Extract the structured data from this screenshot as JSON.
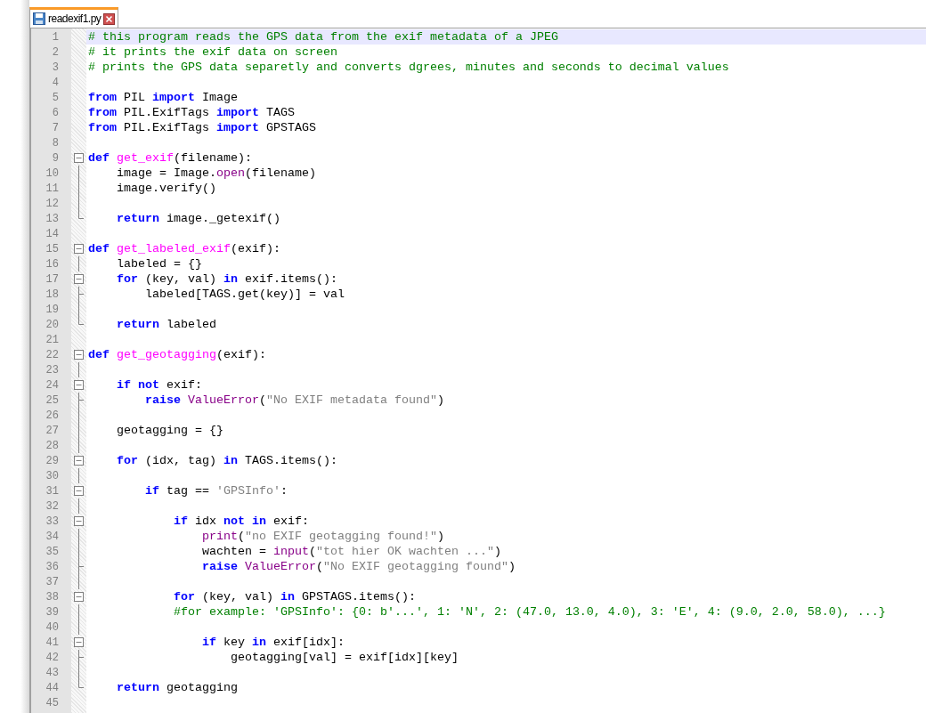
{
  "tab": {
    "title": "readexif1.py",
    "selected": true
  },
  "lines": [
    {
      "number": "1",
      "current": true,
      "kind": "plain",
      "tokens": [
        {
          "kind": "comment",
          "text": "# this program reads the GPS data from the exif metadata of a JPEG"
        }
      ]
    },
    {
      "number": "2",
      "current": false,
      "kind": "plain",
      "tokens": [
        {
          "kind": "comment",
          "text": "# it prints the exif data on screen"
        }
      ]
    },
    {
      "number": "3",
      "current": false,
      "kind": "plain",
      "tokens": [
        {
          "kind": "comment",
          "text": "# prints the GPS data separetly and converts dgrees, minutes and seconds to decimal values"
        }
      ]
    },
    {
      "number": "4",
      "current": false,
      "kind": "plain"
    },
    {
      "number": "5",
      "current": false,
      "kind": "plain",
      "tokens": [
        {
          "kind": "keyword",
          "text": "from"
        },
        {
          "kind": "plain",
          "text": " PIL "
        },
        {
          "kind": "keyword",
          "text": "import"
        },
        {
          "kind": "plain",
          "text": " Image"
        }
      ]
    },
    {
      "number": "6",
      "current": false,
      "kind": "plain",
      "tokens": [
        {
          "kind": "keyword",
          "text": "from"
        },
        {
          "kind": "plain",
          "text": " PIL.ExifTags "
        },
        {
          "kind": "keyword",
          "text": "import"
        },
        {
          "kind": "plain",
          "text": " TAGS"
        }
      ]
    },
    {
      "number": "7",
      "current": false,
      "kind": "plain",
      "tokens": [
        {
          "kind": "keyword",
          "text": "from"
        },
        {
          "kind": "plain",
          "text": " PIL.ExifTags "
        },
        {
          "kind": "keyword",
          "text": "import"
        },
        {
          "kind": "plain",
          "text": " GPSTAGS"
        }
      ]
    },
    {
      "number": "8",
      "current": false,
      "kind": "plain"
    },
    {
      "number": "9",
      "current": false,
      "kind": "fold_start",
      "tokens": [
        {
          "kind": "keyword",
          "text": "def "
        },
        {
          "kind": "defname",
          "text": "get_exif"
        },
        {
          "kind": "plain",
          "text": "(filename):"
        }
      ]
    },
    {
      "number": "10",
      "current": false,
      "kind": "fold_body",
      "tokens": [
        {
          "kind": "plain",
          "text": "    image = Image."
        },
        {
          "kind": "builtin",
          "text": "open"
        },
        {
          "kind": "plain",
          "text": "(filename)"
        }
      ]
    },
    {
      "number": "11",
      "current": false,
      "kind": "fold_body",
      "tokens": [
        {
          "kind": "plain",
          "text": "    image.verify()"
        }
      ]
    },
    {
      "number": "12",
      "current": false,
      "kind": "fold_body"
    },
    {
      "number": "13",
      "current": false,
      "kind": "fold_end",
      "tokens": [
        {
          "kind": "keyword",
          "text": "    return"
        },
        {
          "kind": "plain",
          "text": " image._getexif()"
        }
      ]
    },
    {
      "number": "14",
      "current": false,
      "kind": "plain"
    },
    {
      "number": "15",
      "current": false,
      "kind": "fold_start",
      "tokens": [
        {
          "kind": "keyword",
          "text": "def "
        },
        {
          "kind": "defname",
          "text": "get_labeled_exif"
        },
        {
          "kind": "plain",
          "text": "(exif):"
        }
      ]
    },
    {
      "number": "16",
      "current": false,
      "kind": "fold_body",
      "tokens": [
        {
          "kind": "plain",
          "text": "    labeled = {}"
        }
      ]
    },
    {
      "number": "17",
      "current": false,
      "kind": "fold_start",
      "tokens": [
        {
          "kind": "keyword",
          "text": "    for"
        },
        {
          "kind": "plain",
          "text": " (key, val) "
        },
        {
          "kind": "keyword",
          "text": "in"
        },
        {
          "kind": "plain",
          "text": " exif.items():"
        }
      ]
    },
    {
      "number": "18",
      "current": false,
      "kind": "fold_branch",
      "tokens": [
        {
          "kind": "plain",
          "text": "        labeled[TAGS.get(key)] = val"
        }
      ]
    },
    {
      "number": "19",
      "current": false,
      "kind": "fold_body"
    },
    {
      "number": "20",
      "current": false,
      "kind": "fold_end",
      "tokens": [
        {
          "kind": "keyword",
          "text": "    return"
        },
        {
          "kind": "plain",
          "text": " labeled"
        }
      ]
    },
    {
      "number": "21",
      "current": false,
      "kind": "plain"
    },
    {
      "number": "22",
      "current": false,
      "kind": "fold_start",
      "tokens": [
        {
          "kind": "keyword",
          "text": "def "
        },
        {
          "kind": "defname",
          "text": "get_geotagging"
        },
        {
          "kind": "plain",
          "text": "(exif):"
        }
      ]
    },
    {
      "number": "23",
      "current": false,
      "kind": "fold_body"
    },
    {
      "number": "24",
      "current": false,
      "kind": "fold_start",
      "tokens": [
        {
          "kind": "keyword",
          "text": "    if not"
        },
        {
          "kind": "plain",
          "text": " exif:"
        }
      ]
    },
    {
      "number": "25",
      "current": false,
      "kind": "fold_branch",
      "tokens": [
        {
          "kind": "keyword",
          "text": "        raise "
        },
        {
          "kind": "builtin",
          "text": "ValueError"
        },
        {
          "kind": "plain",
          "text": "("
        },
        {
          "kind": "string",
          "text": "\"No EXIF metadata found\""
        },
        {
          "kind": "plain",
          "text": ")"
        }
      ]
    },
    {
      "number": "26",
      "current": false,
      "kind": "fold_body"
    },
    {
      "number": "27",
      "current": false,
      "kind": "fold_body",
      "tokens": [
        {
          "kind": "plain",
          "text": "    geotagging = {}"
        }
      ]
    },
    {
      "number": "28",
      "current": false,
      "kind": "fold_body"
    },
    {
      "number": "29",
      "current": false,
      "kind": "fold_start",
      "tokens": [
        {
          "kind": "keyword",
          "text": "    for"
        },
        {
          "kind": "plain",
          "text": " (idx, tag) "
        },
        {
          "kind": "keyword",
          "text": "in"
        },
        {
          "kind": "plain",
          "text": " TAGS.items():"
        }
      ]
    },
    {
      "number": "30",
      "current": false,
      "kind": "fold_body"
    },
    {
      "number": "31",
      "current": false,
      "kind": "fold_start",
      "tokens": [
        {
          "kind": "keyword",
          "text": "        if"
        },
        {
          "kind": "plain",
          "text": " tag == "
        },
        {
          "kind": "string",
          "text": "'GPSInfo'"
        },
        {
          "kind": "plain",
          "text": ":"
        }
      ]
    },
    {
      "number": "32",
      "current": false,
      "kind": "fold_body"
    },
    {
      "number": "33",
      "current": false,
      "kind": "fold_start",
      "tokens": [
        {
          "kind": "keyword",
          "text": "            if"
        },
        {
          "kind": "plain",
          "text": " idx "
        },
        {
          "kind": "keyword",
          "text": "not in"
        },
        {
          "kind": "plain",
          "text": " exif:"
        }
      ]
    },
    {
      "number": "34",
      "current": false,
      "kind": "fold_body",
      "tokens": [
        {
          "kind": "builtin",
          "text": "                print"
        },
        {
          "kind": "plain",
          "text": "("
        },
        {
          "kind": "string",
          "text": "\"no EXIF geotagging found!\""
        },
        {
          "kind": "plain",
          "text": ")"
        }
      ]
    },
    {
      "number": "35",
      "current": false,
      "kind": "fold_body",
      "tokens": [
        {
          "kind": "plain",
          "text": "                wachten = "
        },
        {
          "kind": "builtin",
          "text": "input"
        },
        {
          "kind": "plain",
          "text": "("
        },
        {
          "kind": "string",
          "text": "\"tot hier OK wachten ...\""
        },
        {
          "kind": "plain",
          "text": ")"
        }
      ]
    },
    {
      "number": "36",
      "current": false,
      "kind": "fold_branch",
      "tokens": [
        {
          "kind": "keyword",
          "text": "                raise "
        },
        {
          "kind": "builtin",
          "text": "ValueError"
        },
        {
          "kind": "plain",
          "text": "("
        },
        {
          "kind": "string",
          "text": "\"No EXIF geotagging found\""
        },
        {
          "kind": "plain",
          "text": ")"
        }
      ]
    },
    {
      "number": "37",
      "current": false,
      "kind": "fold_body"
    },
    {
      "number": "38",
      "current": false,
      "kind": "fold_start",
      "tokens": [
        {
          "kind": "keyword",
          "text": "            for"
        },
        {
          "kind": "plain",
          "text": " (key, val) "
        },
        {
          "kind": "keyword",
          "text": "in"
        },
        {
          "kind": "plain",
          "text": " GPSTAGS.items():"
        }
      ]
    },
    {
      "number": "39",
      "current": false,
      "kind": "fold_body",
      "tokens": [
        {
          "kind": "comment",
          "text": "            #for example: 'GPSInfo': {0: b'...', 1: 'N', 2: (47.0, 13.0, 4.0), 3: 'E', 4: (9.0, 2.0, 58.0), ...}"
        }
      ]
    },
    {
      "number": "40",
      "current": false,
      "kind": "fold_body"
    },
    {
      "number": "41",
      "current": false,
      "kind": "fold_start",
      "tokens": [
        {
          "kind": "keyword",
          "text": "                if"
        },
        {
          "kind": "plain",
          "text": " key "
        },
        {
          "kind": "keyword",
          "text": "in"
        },
        {
          "kind": "plain",
          "text": " exif[idx]:"
        }
      ]
    },
    {
      "number": "42",
      "current": false,
      "kind": "fold_branch",
      "tokens": [
        {
          "kind": "plain",
          "text": "                    geotagging[val] = exif[idx][key]"
        }
      ]
    },
    {
      "number": "43",
      "current": false,
      "kind": "fold_body"
    },
    {
      "number": "44",
      "current": false,
      "kind": "fold_end",
      "tokens": [
        {
          "kind": "keyword",
          "text": "    return"
        },
        {
          "kind": "plain",
          "text": " geotagging"
        }
      ]
    },
    {
      "number": "45",
      "current": false,
      "kind": "plain"
    }
  ]
}
